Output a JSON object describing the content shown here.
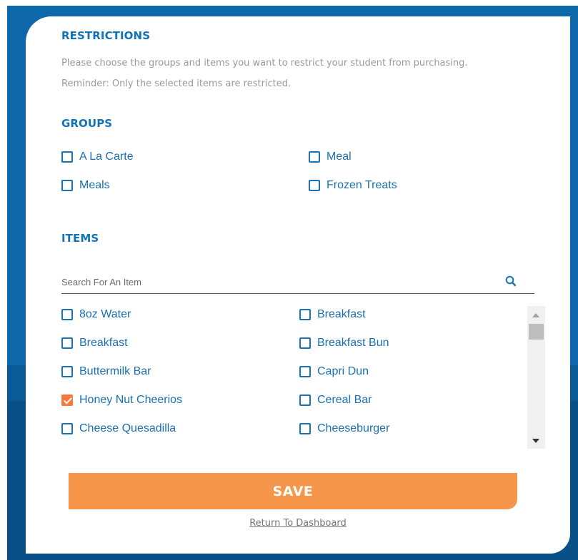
{
  "restrictions": {
    "title": "RESTRICTIONS",
    "description": "Please choose the groups and items you want to restrict your student from purchasing.",
    "reminder": "Reminder: Only the selected items are restricted."
  },
  "groups": {
    "title": "GROUPS",
    "options": [
      {
        "label": "A La Carte",
        "checked": false
      },
      {
        "label": "Meal",
        "checked": false
      },
      {
        "label": "Meals",
        "checked": false
      },
      {
        "label": "Frozen Treats",
        "checked": false
      }
    ]
  },
  "items": {
    "title": "ITEMS",
    "search_placeholder": "Search For An Item",
    "search_value": "",
    "options": [
      {
        "label": "8oz Water",
        "checked": false
      },
      {
        "label": "Breakfast",
        "checked": false
      },
      {
        "label": "Breakfast",
        "checked": false
      },
      {
        "label": "Breakfast Bun",
        "checked": false
      },
      {
        "label": "Buttermilk Bar",
        "checked": false
      },
      {
        "label": "Capri Dun",
        "checked": false
      },
      {
        "label": "Honey Nut Cheerios",
        "checked": true
      },
      {
        "label": "Cereal Bar",
        "checked": false
      },
      {
        "label": "Cheese Quesadilla",
        "checked": false
      },
      {
        "label": "Cheeseburger",
        "checked": false
      }
    ]
  },
  "actions": {
    "save_label": "SAVE",
    "return_label": "Return To Dashboard"
  },
  "colors": {
    "brand_blue": "#1273b4",
    "save_orange": "#f5964a",
    "checked_orange": "#f47a3e"
  },
  "icons": {
    "search": "search-icon",
    "check": "checkmark-icon"
  }
}
